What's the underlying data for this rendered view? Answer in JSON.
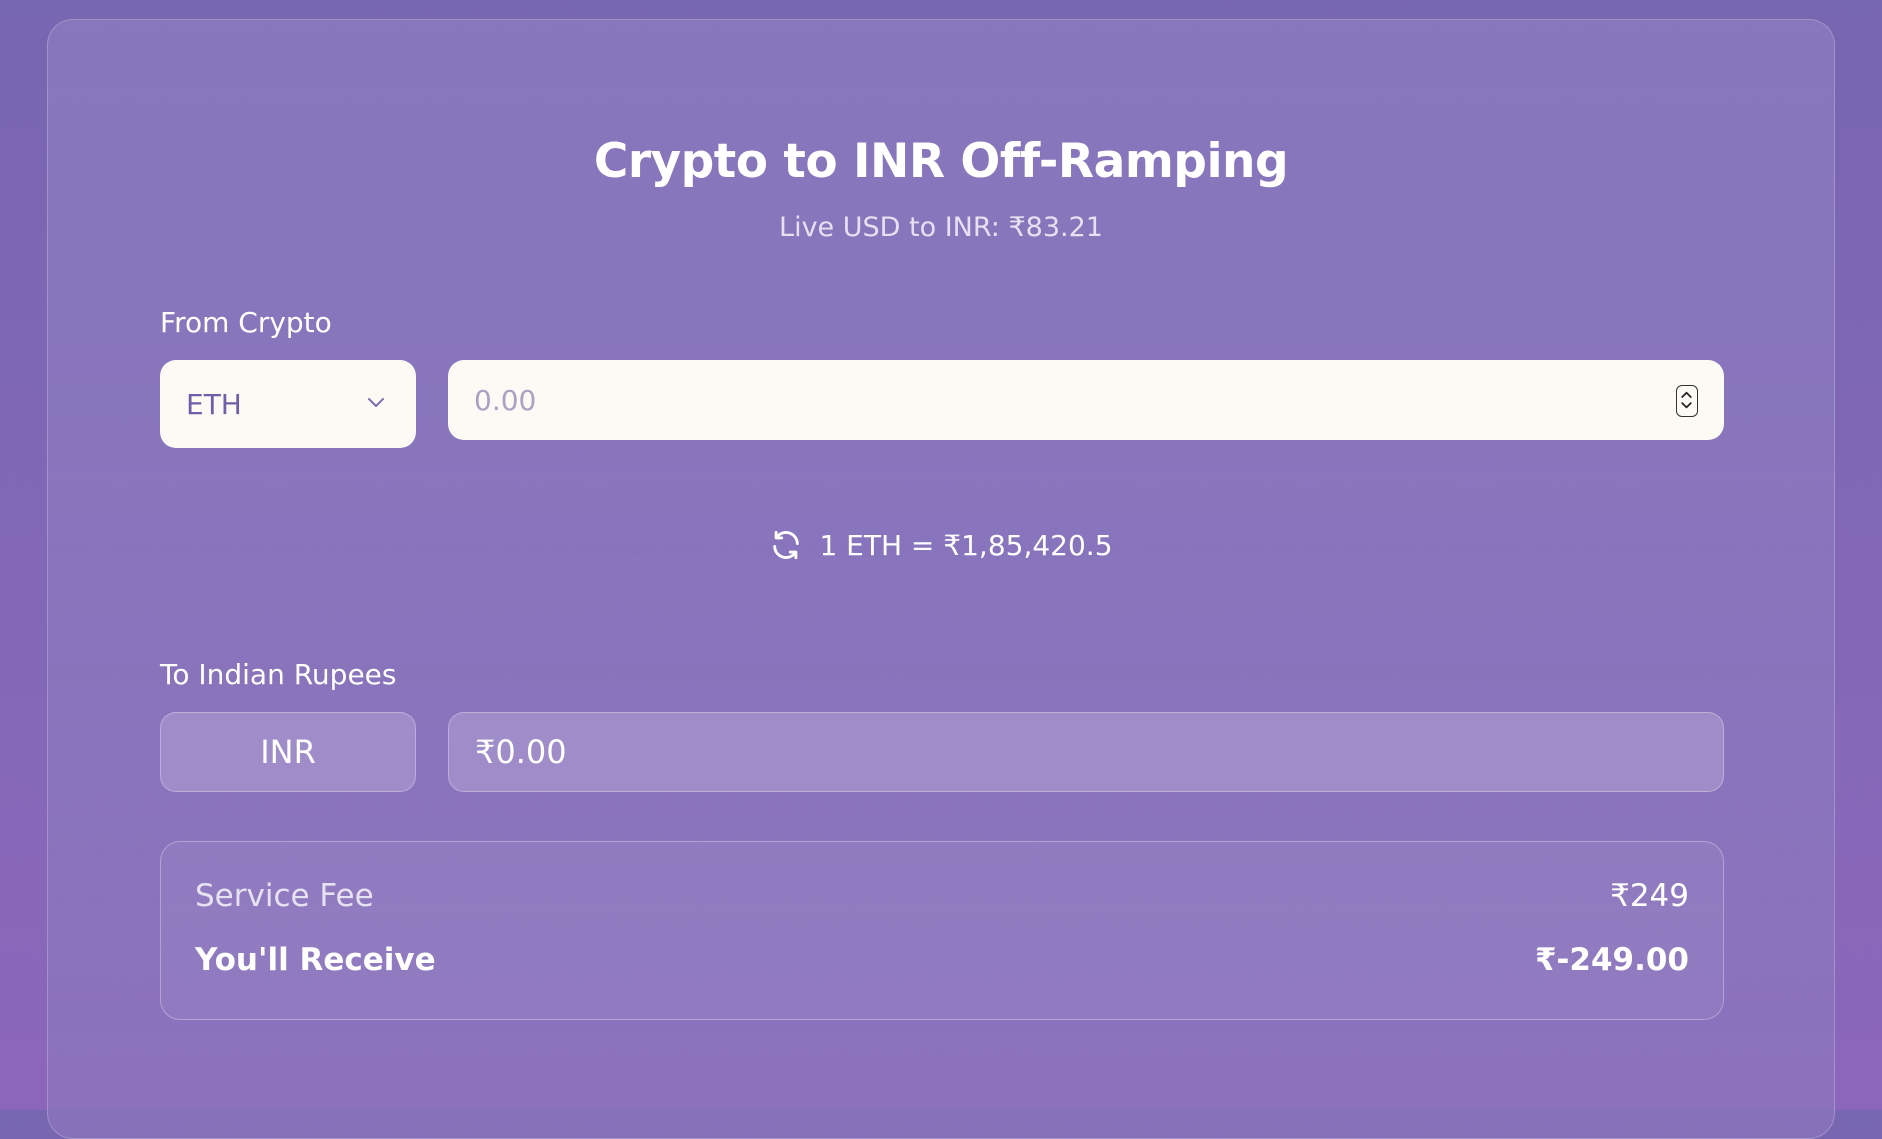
{
  "header": {
    "title": "Crypto to INR Off-Ramping",
    "rate_line": "Live USD to INR: ₹83.21"
  },
  "from": {
    "label": "From Crypto",
    "selected_crypto": "ETH",
    "amount_placeholder": "0.00"
  },
  "conversion": {
    "rate_text": "1 ETH = ₹1,85,420.5",
    "icon": "refresh-icon"
  },
  "to": {
    "label": "To Indian Rupees",
    "currency": "INR",
    "amount_value": "₹0.00"
  },
  "summary": {
    "fee_label": "Service Fee",
    "fee_value": "₹249",
    "receive_label": "You'll Receive",
    "receive_value": "₹-249.00"
  },
  "colors": {
    "background": "#7d67b5",
    "input_background": "#fbfaf5",
    "select_text": "#6f5fa8"
  }
}
